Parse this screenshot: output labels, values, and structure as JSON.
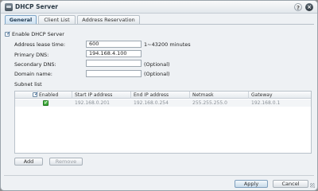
{
  "window": {
    "title": "DHCP Server",
    "help_label": "?",
    "close_label": "×"
  },
  "tabs": [
    {
      "label": "General",
      "active": true
    },
    {
      "label": "Client List",
      "active": false
    },
    {
      "label": "Address Reservation",
      "active": false
    }
  ],
  "form": {
    "enable_label": "Enable DHCP Server",
    "enable_checked": true,
    "lease_label": "Address lease time:",
    "lease_value": "600",
    "lease_hint": "1~43200 minutes",
    "primary_dns_label": "Primary DNS:",
    "primary_dns_value": "194.168.4.100",
    "secondary_dns_label": "Secondary DNS:",
    "secondary_dns_value": "",
    "secondary_dns_hint": "(Optional)",
    "domain_label": "Domain name:",
    "domain_value": "",
    "domain_hint": "(Optional)",
    "subnet_label": "Subnet list"
  },
  "subnet_table": {
    "columns": [
      "Enabled",
      "Start IP address",
      "End IP address",
      "Netmask",
      "Gateway"
    ],
    "rows": [
      {
        "enabled": true,
        "start_ip": "192.168.0.201",
        "end_ip": "192.168.0.254",
        "netmask": "255.255.255.0",
        "gateway": "192.168.0.1"
      }
    ]
  },
  "buttons": {
    "add": "Add",
    "remove": "Remove",
    "apply": "Apply",
    "cancel": "Cancel"
  },
  "colors": {
    "accent": "#7fa6c8",
    "enabled_green": "#2f9a2c"
  },
  "icons": {
    "app": "dhcp-server-icon",
    "help": "help-icon",
    "close": "close-icon"
  }
}
